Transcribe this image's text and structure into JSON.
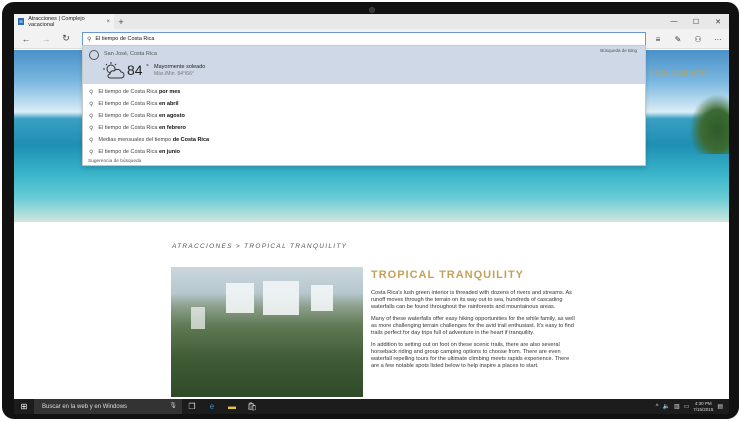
{
  "tab": {
    "title": "Atracciones | Complejo vacacional",
    "favicon": "site-favicon"
  },
  "address": {
    "value": "El tiempo de Costa Rica"
  },
  "weather": {
    "city": "San José, Costa Rica",
    "source": "Búsqueda de Bing",
    "temp": "84",
    "deg": "°",
    "condition": "Mayormente soleado",
    "minmax": "Máx./Mín. 84°/66°"
  },
  "suggestions": [
    {
      "prefix": "El tiempo de Costa Rica ",
      "bold": "por mes"
    },
    {
      "prefix": "El tiempo de Costa Rica ",
      "bold": "en abril"
    },
    {
      "prefix": "El tiempo de Costa Rica ",
      "bold": "en agosto"
    },
    {
      "prefix": "El tiempo de Costa Rica ",
      "bold": "en febrero"
    },
    {
      "prefix": "Medias mensuales del tiempo ",
      "bold": "de Costa Rica"
    },
    {
      "prefix": "El tiempo de Costa Rica ",
      "bold": "en junio"
    }
  ],
  "dropdown_footer": "Sugerencia de búsqueda",
  "page": {
    "phone": "+506-2345-6789",
    "breadcrumb": "ATRACCIONES > TROPICAL TRANQUILITY",
    "title": "TROPICAL TRANQUILITY",
    "paragraphs": [
      "Costa Rica's lush green interior is threaded with dozens of rivers and streams. As runoff moves through the terrain on its way out to sea, hundreds of cascading waterfalls can be found throughout the rainforests and mountainous areas.",
      "Many of these waterfalls offer easy hiking opportunities for the while family, as well as more challenging terrain challenges for the avid trail enthusiast. It's easy to find trails perfect for day trips full of adventure in the heart if tranquility.",
      "In addition to setting out on foot on these scenic trails, there are also several horseback riding and group camping options to choose from. There are even waterfall repelling tours for the ultimate climbing meets rapids experience. There are a few notable spots listed below to help inspire a places to start."
    ]
  },
  "taskbar": {
    "search_placeholder": "Buscar en la web y en Windows",
    "time": "4:30 PM",
    "date": "7/15/2015"
  },
  "colors": {
    "accent_gold": "#c6a05a",
    "address_border": "#6a98d4",
    "weather_bg": "#cfd8e6"
  }
}
